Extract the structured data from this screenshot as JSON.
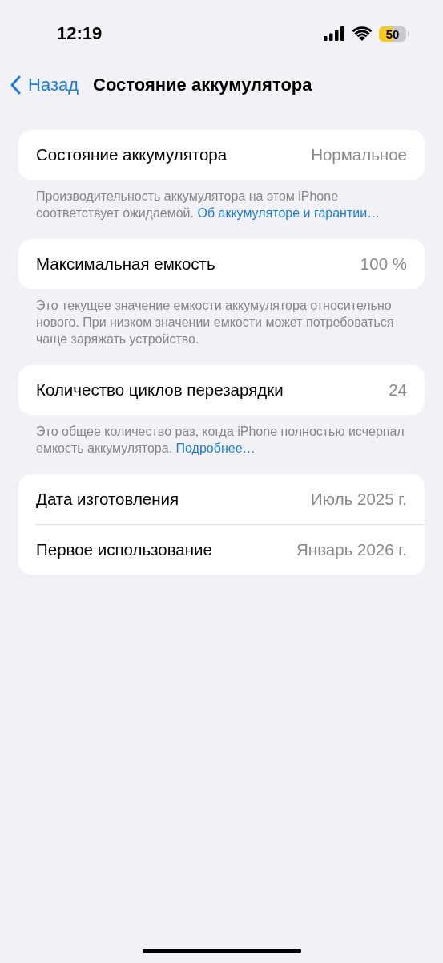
{
  "status_bar": {
    "time": "12:19",
    "battery": "50",
    "low_power_mode": true
  },
  "nav": {
    "back": "Назад",
    "title": "Состояние аккумулятора"
  },
  "sections": [
    {
      "rows": [
        {
          "label": "Состояние аккумулятора",
          "value": "Нормальное"
        }
      ],
      "footer": {
        "text": "Производительность аккумулятора на этом iPhone соответствует ожидаемой.",
        "link": "Об аккумуляторе и гарантии…"
      }
    },
    {
      "rows": [
        {
          "label": "Максимальная емкость",
          "value": "100 %"
        }
      ],
      "footer": {
        "text": "Это текущее значение емкости аккумулятора относительно нового. При низком значении емкости может потребоваться чаще заряжать устройство."
      }
    },
    {
      "rows": [
        {
          "label": "Количество циклов перезарядки",
          "value": "24"
        }
      ],
      "footer": {
        "text": "Это общее количество раз, когда iPhone полностью исчерпал емкость аккумулятора.",
        "link": "Подробнее…"
      }
    },
    {
      "rows": [
        {
          "label": "Дата изготовления",
          "value": "Июль 2025 г."
        },
        {
          "label": "Первое использование",
          "value": "Январь 2026 г."
        }
      ]
    }
  ]
}
